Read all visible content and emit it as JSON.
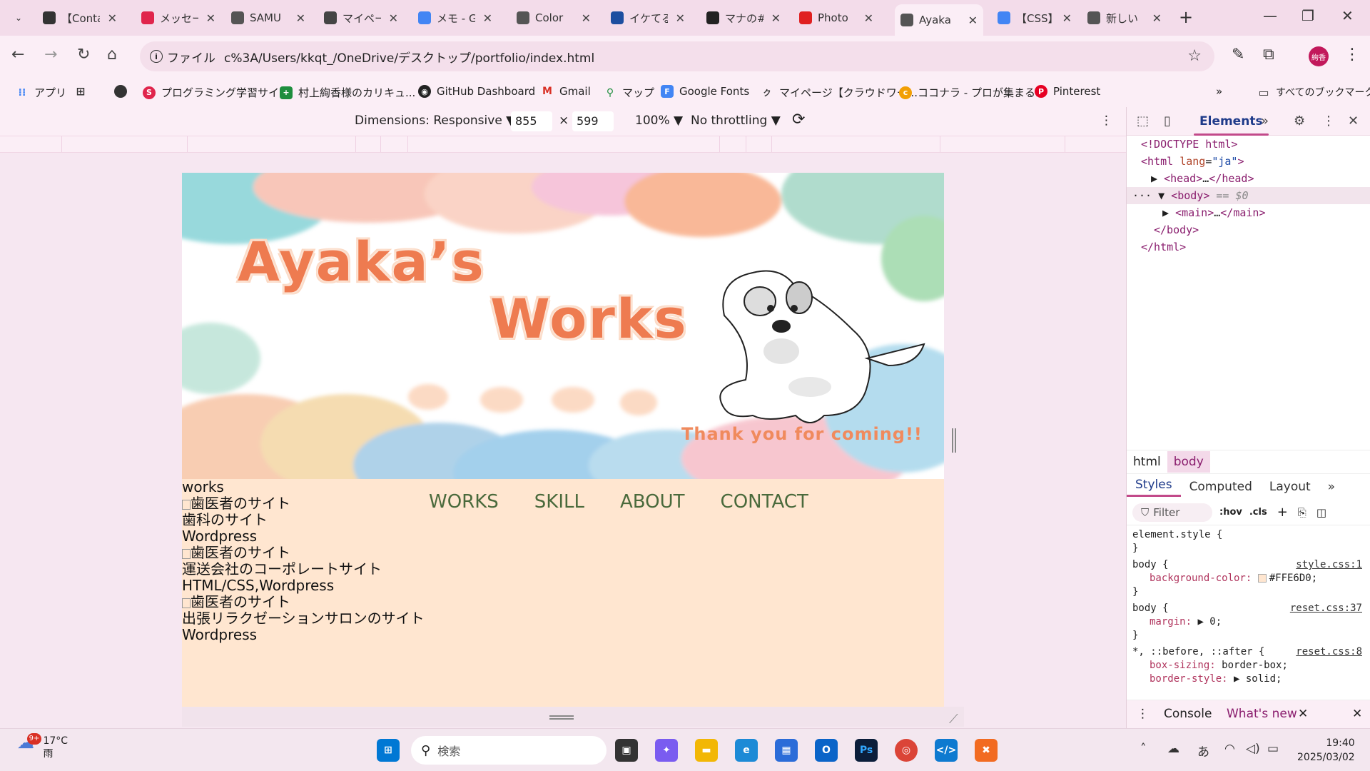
{
  "browser": {
    "tabs": [
      {
        "label": "【Conta",
        "favicon": "WG",
        "color": "#333333"
      },
      {
        "label": "メッセー",
        "favicon": "S",
        "color": "#e0254c"
      },
      {
        "label": "SAMU",
        "favicon": "globe",
        "color": "#555555"
      },
      {
        "label": "マイペー",
        "favicon": "ク",
        "color": "#444444"
      },
      {
        "label": "メモ - G",
        "favicon": "doc",
        "color": "#4285f4"
      },
      {
        "label": "Color",
        "favicon": "globe",
        "color": "#555555"
      },
      {
        "label": "イケてる",
        "favicon": "~",
        "color": "#1d4ea0"
      },
      {
        "label": "マナの#",
        "favicon": "X",
        "color": "#222222"
      },
      {
        "label": "Photo",
        "favicon": "A",
        "color": "#e02020"
      },
      {
        "label": "Ayaka",
        "favicon": "globe",
        "color": "#555555",
        "active": true
      },
      {
        "label": "【CSS】",
        "favicon": "G",
        "color": "#4285f4"
      },
      {
        "label": "新しい",
        "favicon": "chrome",
        "color": "#555555"
      }
    ],
    "address": {
      "scheme_label": "ファイル",
      "url": "c%3A/Users/kkqt_/OneDrive/デスクトップ/portfolio/index.html"
    },
    "profile_label": "絢香",
    "bookmarks": [
      {
        "label": "アプリ",
        "icon": "apps-grid-icon"
      },
      {
        "label": "",
        "icon": "grid-icon"
      },
      {
        "label": "",
        "icon": "globe-icon"
      },
      {
        "label": "プログラミング学習サイ...",
        "icon": "s-logo-icon"
      },
      {
        "label": "村上絢香様のカリキュ...",
        "icon": "sheet-icon"
      },
      {
        "label": "GitHub Dashboard",
        "icon": "github-icon"
      },
      {
        "label": "Gmail",
        "icon": "gmail-icon"
      },
      {
        "label": "マップ",
        "icon": "maps-icon"
      },
      {
        "label": "Google Fonts",
        "icon": "fonts-icon"
      },
      {
        "label": "マイページ【クラウドワー...",
        "icon": "cw-icon"
      },
      {
        "label": "ココナラ - プロが集まる...",
        "icon": "coconala-icon"
      },
      {
        "label": "Pinterest",
        "icon": "pinterest-icon"
      }
    ],
    "all_bookmarks_label": "すべてのブックマーク"
  },
  "device_toolbar": {
    "dimensions_label": "Dimensions: Responsive ▼",
    "width": "855",
    "times": "×",
    "height": "599",
    "zoom": "100% ▼",
    "throttling": "No throttling ▼"
  },
  "page": {
    "hero": {
      "title_line1": "Ayaka’s",
      "title_line2": "Works",
      "thanks": "Thank you for coming!!"
    },
    "works_heading": "works",
    "works": [
      {
        "img_alt": "歯医者のサイト",
        "title": "歯科のサイト",
        "tech": "Wordpress"
      },
      {
        "img_alt": "歯医者のサイト",
        "title": "運送会社のコーポレートサイト",
        "tech": "HTML/CSS,Wordpress"
      },
      {
        "img_alt": "歯医者のサイト",
        "title": "出張リラクゼーションサロンのサイト",
        "tech": "Wordpress"
      }
    ],
    "nav": [
      "WORKS",
      "SKILL",
      "ABOUT",
      "CONTACT"
    ],
    "background_color": "#FFE6D0",
    "nav_color": "#4a6a3c"
  },
  "devtools": {
    "active_tab": "Elements",
    "dom": {
      "doctype": "<!DOCTYPE html>",
      "html_open": "<html",
      "lang_attr": "lang",
      "lang_val": "\"ja\"",
      "head": "<head>",
      "head_close": "</head>",
      "body": "<body>",
      "body_marker": "== $0",
      "main": "<main>",
      "main_close": "</main>",
      "body_close": "</body>",
      "html_close": "</html>"
    },
    "breadcrumbs": [
      "html",
      "body"
    ],
    "style_tabs": [
      "Styles",
      "Computed",
      "Layout"
    ],
    "filter_placeholder": "Filter",
    "filter_hov": ":hov",
    "filter_cls": ".cls",
    "rules": [
      {
        "selector": "element.style {",
        "source": "",
        "props": [],
        "close": "}"
      },
      {
        "selector": "body {",
        "source": "style.css:1",
        "props": [
          {
            "name": "background-color",
            "value": "#FFE6D0;",
            "swatch": true
          }
        ],
        "close": "}"
      },
      {
        "selector": "body {",
        "source": "reset.css:37",
        "props": [
          {
            "name": "margin",
            "value": "▶ 0;"
          }
        ],
        "close": "}"
      },
      {
        "selector": "*, ::before, ::after {",
        "source": "reset.css:8",
        "props": [
          {
            "name": "box-sizing",
            "value": "border-box;"
          },
          {
            "name": "border-style",
            "value": "▶ solid;"
          }
        ],
        "close": ""
      }
    ],
    "footer_tabs": [
      "Console",
      "What's new"
    ]
  },
  "taskbar": {
    "weather_temp": "17°C",
    "weather_desc": "雨",
    "badge": "9+",
    "search_placeholder": "検索",
    "ime": "あ",
    "time": "19:40",
    "date": "2025/03/02"
  }
}
